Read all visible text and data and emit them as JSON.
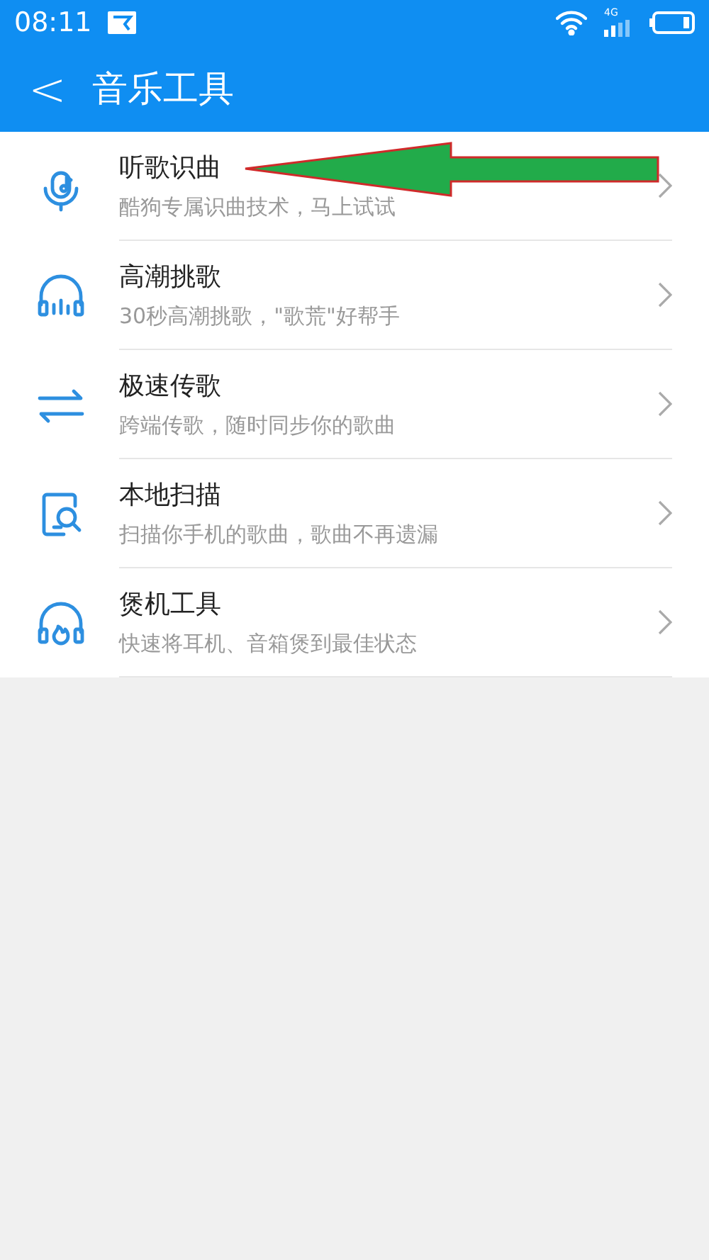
{
  "status_bar": {
    "time": "08:11",
    "network": "4G"
  },
  "header": {
    "back": "<",
    "title": "音乐工具"
  },
  "items": [
    {
      "kind": "mic",
      "title": "听歌识曲",
      "subtitle": "酷狗专属识曲技术，马上试试"
    },
    {
      "kind": "headphones",
      "title": "高潮挑歌",
      "subtitle": "30秒高潮挑歌，\"歌荒\"好帮手"
    },
    {
      "kind": "transfer",
      "title": "极速传歌",
      "subtitle": "跨端传歌，随时同步你的歌曲"
    },
    {
      "kind": "scan",
      "title": "本地扫描",
      "subtitle": "扫描你手机的歌曲，歌曲不再遗漏"
    },
    {
      "kind": "burn",
      "title": "煲机工具",
      "subtitle": "快速将耳机、音箱煲到最佳状态"
    }
  ]
}
